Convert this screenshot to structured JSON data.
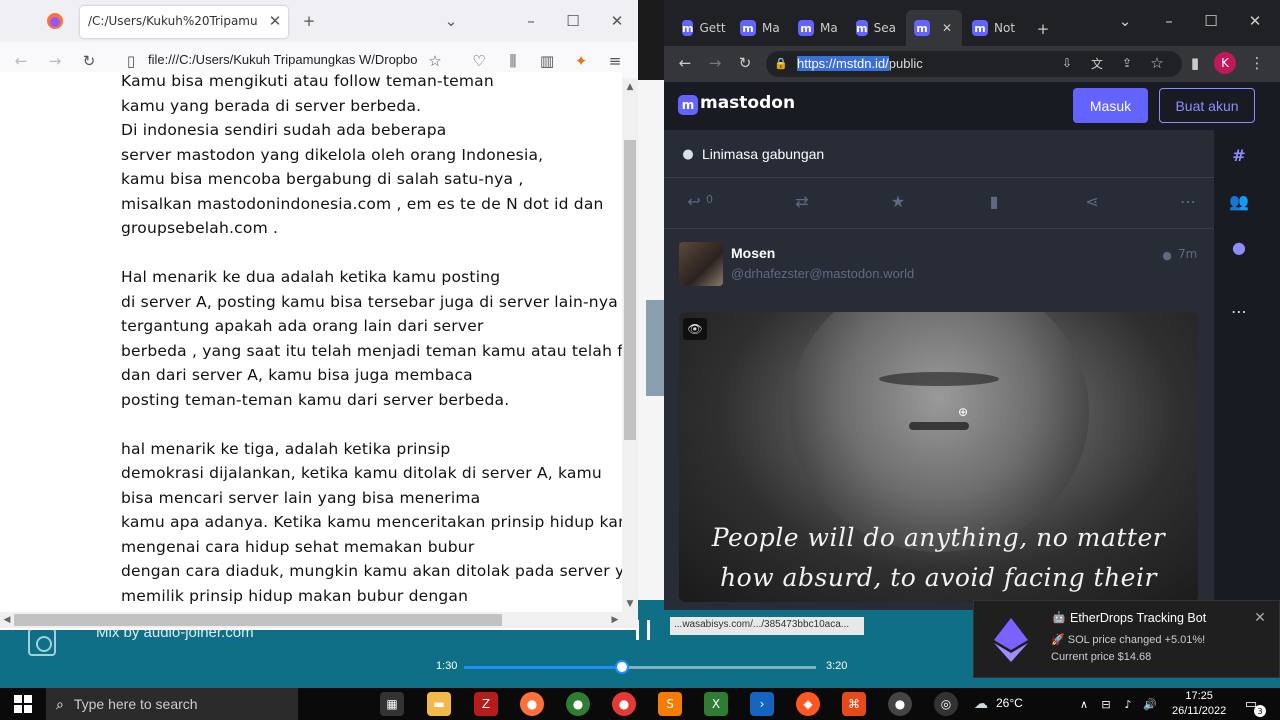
{
  "player": {
    "title": "Mix by audio-joiner.com",
    "time_current": "1:30",
    "time_total": "3:20",
    "progress": 0.45
  },
  "firefox": {
    "tab_title": "/C:/Users/Kukuh%20Tripamungkas%",
    "url": "file:///C:/Users/Kukuh Tripamungkas W/Dropbo",
    "document_lines": [
      "Kamu bisa mengikuti atau follow teman-teman",
      "kamu yang berada di server berbeda.",
      "Di indonesia sendiri sudah ada beberapa",
      "server mastodon yang dikelola oleh orang Indonesia,",
      "kamu bisa mencoba bergabung di salah satu-nya ,",
      "misalkan mastodonindonesia.com , em es te de N dot id dan",
      "groupsebelah.com .",
      "",
      "Hal menarik ke dua adalah ketika kamu posting",
      "di server A, posting kamu bisa tersebar juga di server lain-nya",
      "tergantung apakah ada orang lain dari server",
      "berbeda , yang saat itu telah menjadi teman kamu atau telah f",
      "dan dari server A, kamu bisa juga membaca",
      "posting teman-teman kamu dari server berbeda.",
      "",
      "hal menarik ke tiga, adalah ketika prinsip",
      "demokrasi dijalankan, ketika kamu ditolak di server A, kamu",
      "bisa mencari server lain yang bisa menerima",
      "kamu apa adanya. Ketika kamu menceritakan prinsip hidup kam",
      "mengenai cara hidup sehat memakan bubur",
      "dengan cara diaduk, mungkin kamu akan ditolak pada server yg",
      "memilik prinsip hidup makan bubur dengan"
    ]
  },
  "chrome": {
    "tabs": [
      "Gett",
      "Ma",
      "Ma",
      "Sea",
      "",
      "Not"
    ],
    "url_selected": "https://mstdn.id/",
    "url_rest": "public",
    "profile_initial": "K"
  },
  "mastodon": {
    "logo": "mastodon",
    "login_label": "Masuk",
    "signup_label": "Buat akun",
    "column_title": "Linimasa gabungan",
    "reply_count": "0",
    "post": {
      "name": "Mosen",
      "handle": "@drhafezster@mastodon.world",
      "time": "7m",
      "quote_line1": "People will do anything, no matter",
      "quote_line2": "how absurd, to avoid facing their"
    },
    "status_url": "...wasabisys.com/.../385473bbc10aca..."
  },
  "notification": {
    "title": "EtherDrops Tracking Bot",
    "line1": "🚀 SOL price changed +5.01%!",
    "line2": "Current price $14.68"
  },
  "taskbar": {
    "search_placeholder": "Type here to search",
    "temperature": "26°C",
    "time": "17:25",
    "date": "26/11/2022",
    "notif_count": "3"
  },
  "colors": {
    "mastodon_accent": "#6364ff",
    "player_bg": "#0f6f86",
    "seek_accent": "#1e90ff"
  }
}
